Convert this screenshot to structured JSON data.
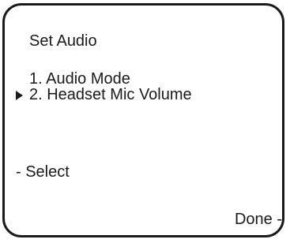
{
  "screen": {
    "title": "Set Audio",
    "menu": [
      {
        "label": "1. Audio Mode",
        "selected": false
      },
      {
        "label": "2. Headset Mic Volume",
        "selected": true
      }
    ],
    "softkeys": {
      "left": "- Select",
      "right": "Done -"
    }
  },
  "icons": {
    "selection_pointer": "triangle-right-icon"
  }
}
